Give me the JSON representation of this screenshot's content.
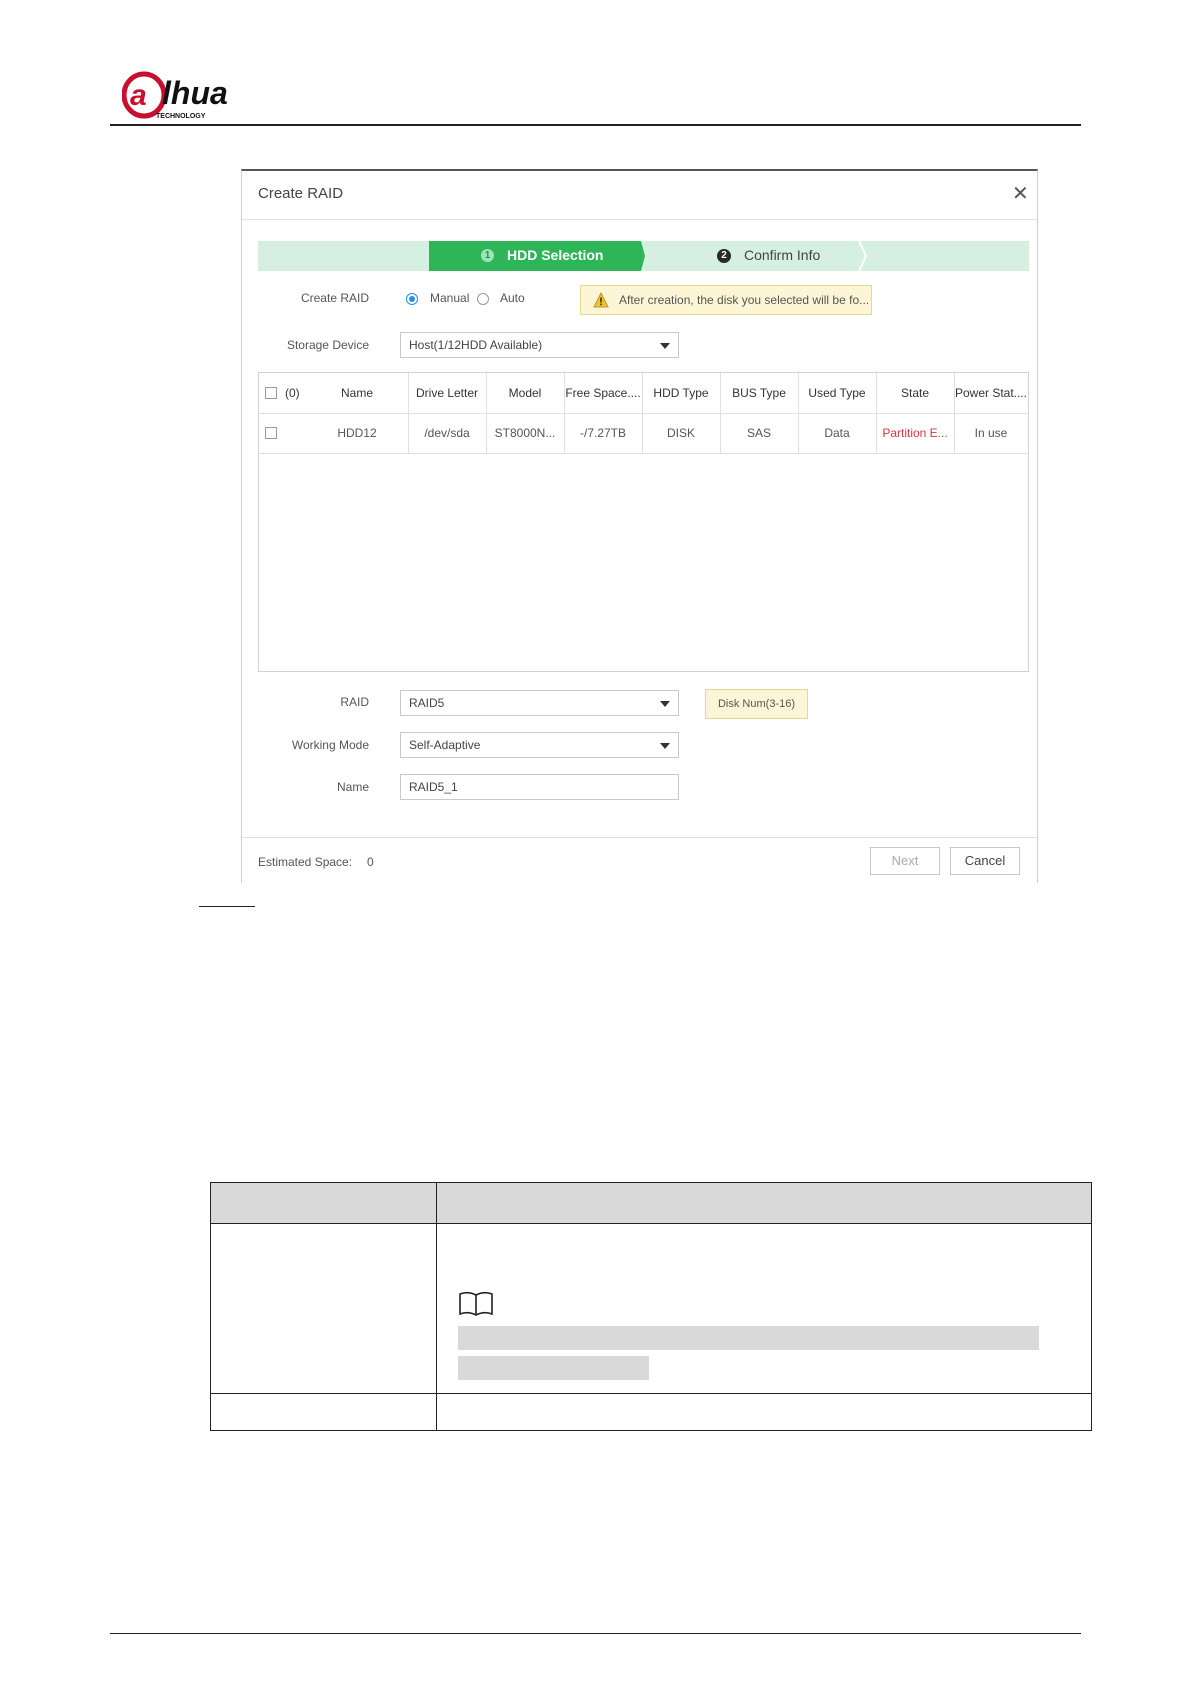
{
  "brand": {
    "logo_text": "alhua",
    "logo_sub": "TECHNOLOGY",
    "logo_color": "#c8102e"
  },
  "dialog": {
    "title": "Create RAID",
    "close_icon": "close-icon",
    "steps": [
      {
        "num": "1",
        "label": "HDD Selection",
        "active": true
      },
      {
        "num": "2",
        "label": "Confirm Info",
        "active": false
      }
    ],
    "create_raid": {
      "label": "Create RAID",
      "options": [
        {
          "label": "Manual",
          "selected": true
        },
        {
          "label": "Auto",
          "selected": false
        }
      ],
      "warning": "After creation, the disk you selected will be fo..."
    },
    "storage_device": {
      "label": "Storage Device",
      "value": "Host(1/12HDD Available)"
    },
    "table": {
      "select_count": "(0)",
      "columns": [
        "Name",
        "Drive Letter",
        "Model",
        "Free Space....",
        "HDD Type",
        "BUS Type",
        "Used Type",
        "State",
        "Power Stat...."
      ],
      "rows": [
        {
          "name": "HDD12",
          "drive_letter": "/dev/sda",
          "model": "ST8000N...",
          "free_space": "-/7.27TB",
          "hdd_type": "DISK",
          "bus_type": "SAS",
          "used_type": "Data",
          "state": "Partition E...",
          "power_status": "In use"
        }
      ]
    },
    "raid": {
      "label": "RAID",
      "value": "RAID5",
      "hint": "Disk Num(3-16)"
    },
    "working_mode": {
      "label": "Working Mode",
      "value": "Self-Adaptive"
    },
    "name": {
      "label": "Name",
      "value": "RAID5_1"
    },
    "footer": {
      "estimated_label": "Estimated Space:",
      "estimated_value": "0",
      "next_label": "Next",
      "cancel_label": "Cancel"
    }
  },
  "colors": {
    "step_active": "#2eb558",
    "step_bar": "#d5f0e1",
    "warning_bg": "#fdf6d6",
    "state_error": "#d9363e",
    "radio_on": "#2a8ee8"
  }
}
